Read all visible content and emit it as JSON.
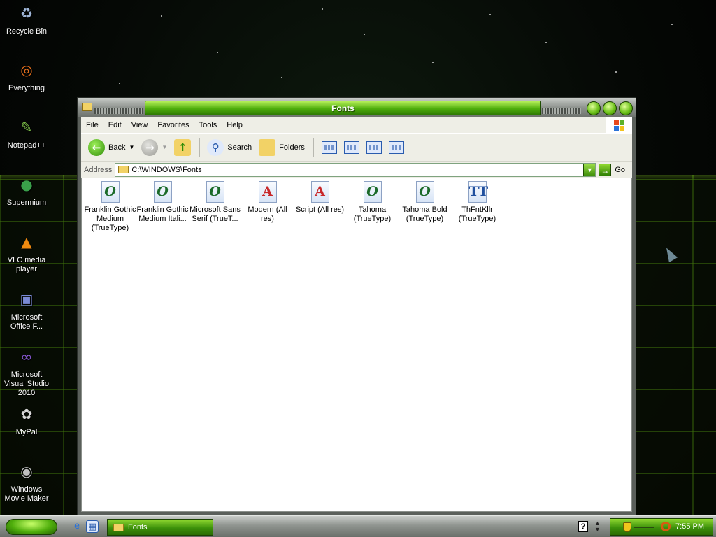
{
  "desktop": {
    "icons": [
      {
        "label": "Recycle Bin",
        "icon": "recycle-bin-icon",
        "glyph": "♻",
        "color": "#9fb6d8"
      },
      {
        "label": "Everything",
        "icon": "everything-icon",
        "glyph": "◎",
        "color": "#e8701c"
      },
      {
        "label": "Notepad++",
        "icon": "notepad-plus-plus-icon",
        "glyph": "✎",
        "color": "#7fc34a"
      },
      {
        "label": "Supermium",
        "icon": "supermium-icon",
        "glyph": "●",
        "color": "#3aa04a"
      },
      {
        "label": "VLC media player",
        "icon": "vlc-icon",
        "glyph": "▲",
        "color": "#f08a10"
      },
      {
        "label": "Microsoft Office F...",
        "icon": "office-icon",
        "glyph": "▣",
        "color": "#7a8ad6"
      },
      {
        "label": "Microsoft Visual Studio 2010",
        "icon": "visual-studio-icon",
        "glyph": "∞",
        "color": "#8a5ad6"
      },
      {
        "label": "MyPal",
        "icon": "mypal-icon",
        "glyph": "✿",
        "color": "#d8d8d8"
      },
      {
        "label": "Windows Movie Maker",
        "icon": "movie-maker-icon",
        "glyph": "◉",
        "color": "#c0c0c0"
      }
    ]
  },
  "window": {
    "title": "Fonts",
    "menu": [
      "File",
      "Edit",
      "View",
      "Favorites",
      "Tools",
      "Help"
    ],
    "toolbar": {
      "back_label": "Back",
      "search_label": "Search",
      "folders_label": "Folders"
    },
    "address": {
      "label": "Address",
      "value": "C:\\WINDOWS\\Fonts",
      "go_label": "Go"
    },
    "files": [
      {
        "name": "Franklin Gothic Medium (TrueType)",
        "glyph": "O",
        "kind": "o"
      },
      {
        "name": "Franklin Gothic Medium Itali...",
        "glyph": "O",
        "kind": "o"
      },
      {
        "name": "Microsoft Sans Serif (TrueT...",
        "glyph": "O",
        "kind": "o"
      },
      {
        "name": "Modern (All res)",
        "glyph": "A",
        "kind": "a"
      },
      {
        "name": "Script (All res)",
        "glyph": "A",
        "kind": "a"
      },
      {
        "name": "Tahoma (TrueType)",
        "glyph": "O",
        "kind": "o"
      },
      {
        "name": "Tahoma Bold (TrueType)",
        "glyph": "O",
        "kind": "o"
      },
      {
        "name": "ThFntKllr (TrueType)",
        "glyph": "TT",
        "kind": "t"
      }
    ]
  },
  "taskbar": {
    "task_label": "Fonts",
    "clock": "7:55 PM",
    "help_glyph": "?"
  },
  "colors": {
    "accent_green": "#4fae0c",
    "window_frame": "#5a5f5a"
  }
}
